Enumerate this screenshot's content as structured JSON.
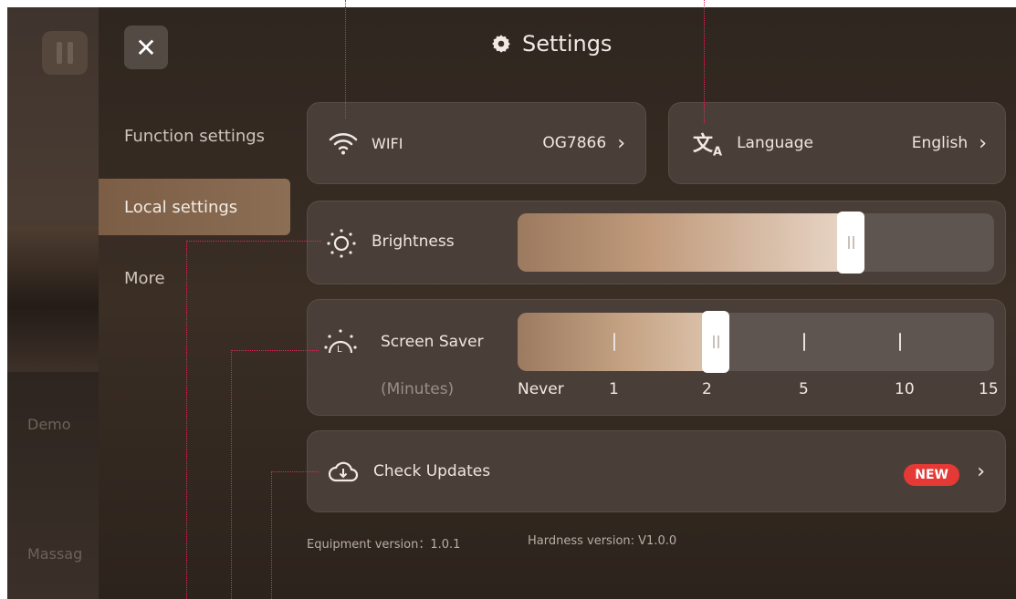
{
  "background_app": {
    "labels": [
      "Demo",
      "Massag"
    ]
  },
  "header": {
    "title": "Settings",
    "close_icon": "close-icon",
    "title_icon": "gear-icon"
  },
  "sidebar": {
    "items": [
      {
        "label": "Function settings",
        "active": false
      },
      {
        "label": "Local settings",
        "active": true
      },
      {
        "label": "More",
        "active": false
      }
    ]
  },
  "wifi": {
    "label": "WIFI",
    "value": "OG7866",
    "icon": "wifi-icon"
  },
  "language": {
    "label": "Language",
    "value": "English",
    "icon": "translate-icon"
  },
  "brightness": {
    "label": "Brightness",
    "icon": "sun-icon",
    "level_percent": 70
  },
  "screen_saver": {
    "label": "Screen Saver",
    "unit_label": "(Minutes)",
    "options": [
      "Never",
      "1",
      "2",
      "5",
      "10",
      "15"
    ],
    "selected": "2",
    "icon": "screen-saver-icon"
  },
  "check_updates": {
    "label": "Check Updates",
    "badge": "NEW",
    "icon": "cloud-download-icon"
  },
  "versions": {
    "equipment": "Equipment version：1.0.1",
    "hardness": "Hardness version: V1.0.0"
  },
  "colors": {
    "accent": "#c19b7c",
    "badge": "#e53935",
    "annotation": "#e0245e"
  }
}
